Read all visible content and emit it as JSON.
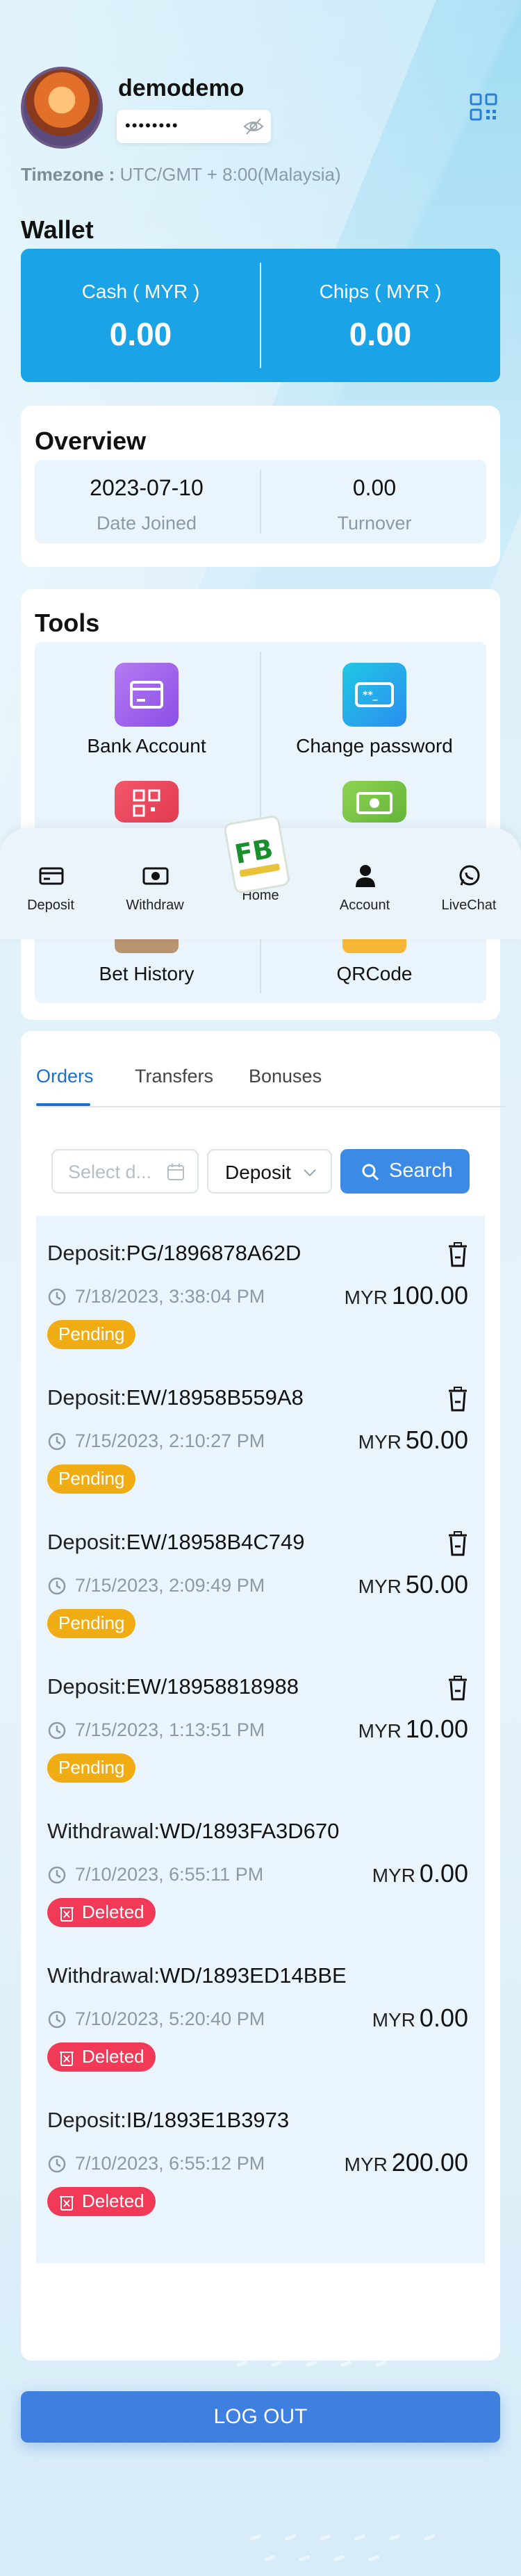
{
  "profile": {
    "username": "demodemo",
    "password_mask": "••••••••",
    "timezone_label": "Timezone :",
    "timezone_value": "UTC/GMT + 8:00(Malaysia)"
  },
  "wallet": {
    "title": "Wallet",
    "cash_label": "Cash ( MYR )",
    "cash_value": "0.00",
    "chips_label": "Chips ( MYR )",
    "chips_value": "0.00"
  },
  "overview": {
    "title": "Overview",
    "date_joined_value": "2023-07-10",
    "date_joined_label": "Date Joined",
    "turnover_value": "0.00",
    "turnover_label": "Turnover"
  },
  "tools": {
    "title": "Tools",
    "items": [
      {
        "label": "Bank Account",
        "icon": "bank-card-icon"
      },
      {
        "label": "Change password",
        "icon": "password-icon"
      },
      {
        "label": "Bet History",
        "icon": "bet-history-icon"
      },
      {
        "label": "QRCode",
        "icon": "qrcode-icon"
      }
    ]
  },
  "bottom_nav": {
    "items": [
      {
        "label": "Deposit",
        "icon": "deposit-icon"
      },
      {
        "label": "Withdraw",
        "icon": "withdraw-icon"
      },
      {
        "label": "Home",
        "icon": "home-logo-icon"
      },
      {
        "label": "Account",
        "icon": "account-icon"
      },
      {
        "label": "LiveChat",
        "icon": "livechat-icon"
      }
    ]
  },
  "records": {
    "tabs": [
      "Orders",
      "Transfers",
      "Bonuses"
    ],
    "active_tab": "Orders",
    "filter": {
      "date_placeholder": "Select d...",
      "type_value": "Deposit",
      "search_label": "Search"
    },
    "orders": [
      {
        "type": "Deposit:",
        "id": "PG/1896878A62D",
        "date": "7/18/2023, 3:38:04 PM",
        "currency": "MYR",
        "amount": "100.00",
        "status": "Pending",
        "deletable": true
      },
      {
        "type": "Deposit:",
        "id": "EW/18958B559A8",
        "date": "7/15/2023, 2:10:27 PM",
        "currency": "MYR",
        "amount": "50.00",
        "status": "Pending",
        "deletable": true
      },
      {
        "type": "Deposit:",
        "id": "EW/18958B4C749",
        "date": "7/15/2023, 2:09:49 PM",
        "currency": "MYR",
        "amount": "50.00",
        "status": "Pending",
        "deletable": true
      },
      {
        "type": "Deposit:",
        "id": "EW/18958818988",
        "date": "7/15/2023, 1:13:51 PM",
        "currency": "MYR",
        "amount": "10.00",
        "status": "Pending",
        "deletable": true
      },
      {
        "type": "Withdrawal:",
        "id": "WD/1893FA3D670",
        "date": "7/10/2023, 6:55:11 PM",
        "currency": "MYR",
        "amount": "0.00",
        "status": "Deleted",
        "deletable": false
      },
      {
        "type": "Withdrawal:",
        "id": "WD/1893ED14BBE",
        "date": "7/10/2023, 5:20:40 PM",
        "currency": "MYR",
        "amount": "0.00",
        "status": "Deleted",
        "deletable": false
      },
      {
        "type": "Deposit:",
        "id": "IB/1893E1B3973",
        "date": "7/10/2023, 6:55:12 PM",
        "currency": "MYR",
        "amount": "200.00",
        "status": "Deleted",
        "deletable": false
      }
    ]
  },
  "logout_label": "LOG OUT",
  "colors": {
    "wallet_bg": "#1aa3e6",
    "pending": "#f0ad13",
    "deleted": "#f13a57",
    "accent": "#3a8ae6"
  }
}
